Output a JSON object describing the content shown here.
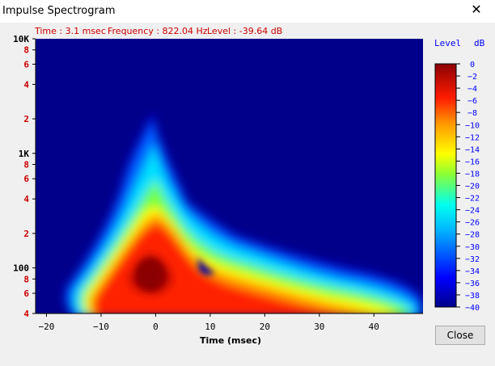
{
  "window": {
    "title": "Impulse Spectrogram",
    "close_glyph": "✕",
    "close_icon": "close-icon"
  },
  "readout": {
    "time": "Time : 3.1 msec",
    "frequency": "Frequency : 822.04 Hz",
    "level": "Level : -39.64 dB"
  },
  "buttons": {
    "close_label": "Close"
  },
  "colors": {
    "plot_background": "#00008b",
    "readout_text": "#cc0000",
    "y_tick_text": "#cc0000",
    "colorbar_text": "#0000ff"
  },
  "chart_data": {
    "type": "heatmap",
    "xlabel": "Time (msec)",
    "x_ticks": [
      -20,
      -10,
      0,
      10,
      20,
      30,
      40
    ],
    "x_tick_labels": [
      "−20",
      "−10",
      "0",
      "10",
      "20",
      "30",
      "40"
    ],
    "xlim": [
      -22,
      49
    ],
    "y_scale": "log",
    "ylim": [
      40,
      10000
    ],
    "y_ticks": [
      {
        "value": 10000,
        "label": "10K",
        "major": true
      },
      {
        "value": 8000,
        "label": "8",
        "major": false
      },
      {
        "value": 6000,
        "label": "6",
        "major": false
      },
      {
        "value": 4000,
        "label": "4",
        "major": false
      },
      {
        "value": 2000,
        "label": "2",
        "major": false
      },
      {
        "value": 1000,
        "label": "1K",
        "major": true
      },
      {
        "value": 800,
        "label": "8",
        "major": false
      },
      {
        "value": 600,
        "label": "6",
        "major": false
      },
      {
        "value": 400,
        "label": "4",
        "major": false
      },
      {
        "value": 200,
        "label": "2",
        "major": false
      },
      {
        "value": 100,
        "label": "100",
        "major": true
      },
      {
        "value": 80,
        "label": "8",
        "major": false
      },
      {
        "value": 60,
        "label": "6",
        "major": false
      },
      {
        "value": 40,
        "label": "4",
        "major": false
      }
    ],
    "colorbar": {
      "title_left": "Level",
      "title_right": "dB",
      "range": [
        -40,
        0
      ],
      "ticks": [
        "0",
        "−2",
        "−4",
        "−6",
        "−8",
        "−10",
        "−12",
        "−14",
        "−16",
        "−18",
        "−20",
        "−22",
        "−24",
        "−26",
        "−28",
        "−30",
        "−32",
        "−34",
        "−36",
        "−38",
        "−40"
      ],
      "tick_values": [
        0,
        -2,
        -4,
        -6,
        -8,
        -10,
        -12,
        -14,
        -16,
        -18,
        -20,
        -22,
        -24,
        -26,
        -28,
        -30,
        -32,
        -34,
        -36,
        -38,
        -40
      ]
    },
    "peak": {
      "time_ms": -1,
      "frequency_hz": 90,
      "level_db": 0
    }
  }
}
